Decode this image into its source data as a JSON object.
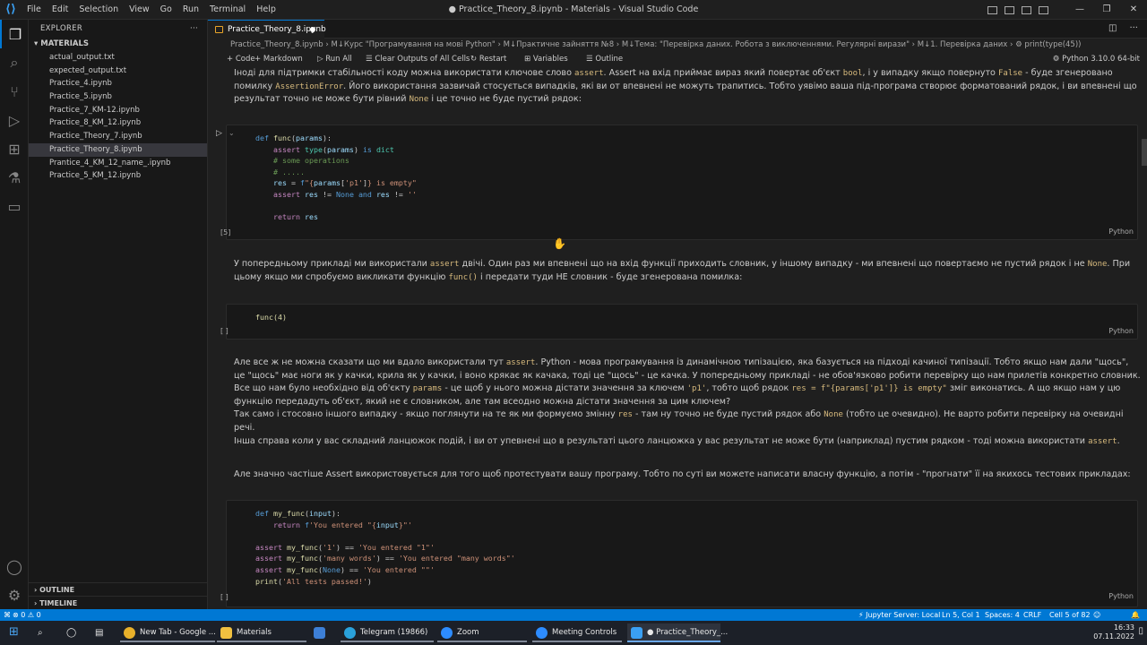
{
  "window": {
    "title": "● Practice_Theory_8.ipynb - Materials - Visual Studio Code",
    "menu": [
      "File",
      "Edit",
      "Selection",
      "View",
      "Go",
      "Run",
      "Terminal",
      "Help"
    ]
  },
  "sidebar": {
    "header": "EXPLORER",
    "folder": "MATERIALS",
    "files": [
      "actual_output.txt",
      "expected_output.txt",
      "Practice_4.ipynb",
      "Practice_5.ipynb",
      "Practice_7_KM-12.ipynb",
      "Practice_8_KM_12.ipynb",
      "Practice_Theory_7.ipynb",
      "Practice_Theory_8.ipynb",
      "Prantice_4_KM_12_name_.ipynb",
      "Practice_5_KM_12.ipynb"
    ],
    "active_index": 7,
    "outline": "OUTLINE",
    "timeline": "TIMELINE"
  },
  "tab": {
    "label": "Practice_Theory_8.ipynb"
  },
  "breadcrumb": "Practice_Theory_8.ipynb › M↓Курс \"Програмування на мові Python\" › M↓Практичне зайняття №8 › M↓Тема: \"Перевірка даних. Робота з виключеннями. Регулярні вирази\" › M↓1. Перевірка даних › ⚙ print(type(45))",
  "toolbar": {
    "code": "+ Code",
    "markdown": "+ Markdown",
    "run_all": "▷ Run All",
    "clear": "☰ Clear Outputs of All Cells",
    "restart": "↻ Restart",
    "variables": "⊞ Variables",
    "outline": "☰ Outline",
    "kernel": "Python 3.10.0 64-bit"
  },
  "cells": {
    "md1_a": "Іноді для підтримки стабільності коду можна використати ключове слово ",
    "md1_assert": "assert",
    "md1_b": ". Assert на вхід приймає вираз який повертає об'єкт ",
    "md1_bool": "bool",
    "md1_c": ", і у випадку якщо повернуто ",
    "md1_false": "False",
    "md1_d": " - буде згенеровано помилку ",
    "md1_err": "AssertionError",
    "md1_e": ". Його використання зазвичай стосується випадків, які ви от впевнені не можуть трапитись. Тобто уявімо ваша під-програма створює форматований рядок, і ви впевнені що результат точно не може бути рівний ",
    "md1_none": "None",
    "md1_f": " і це точно не буде пустий рядок:",
    "c1_exec": "[5]",
    "c1_lang": "Python",
    "md2_a": "У попередньому прикладі ми використали ",
    "md2_assert": "assert",
    "md2_b": " двічі. Один раз ми впевнені що на вхід функції приходить словник, у іншому випадку - ми впевнені що повертаємо не пустий рядок і не ",
    "md2_none": "None",
    "md2_c": ". При цьому якщо ми спробуємо викликати функцію ",
    "md2_func": "func()",
    "md2_d": " і передати туди НЕ словник - буде згенерована помилка:",
    "c2_code": "func(4)",
    "c2_exec": "[ ]",
    "c2_lang": "Python",
    "md3_a": "Але все ж не можна сказати що ми вдало використали тут ",
    "md3_assert": "assert",
    "md3_b": ". Python - мова програмування із динамічною типізацією, яка базується на підході качиної типізації. Тобто якщо нам дали \"щось\", це \"щось\" має ноги як у качки, крила як у качки, і воно крякає як качака, тоді це \"щось\" - це качка. У попередньому прикладі - не обов'язково робити перевірку що нам прилетів конкретно словник. Все що нам було необхідно від об'єкту ",
    "md3_params": "params",
    "md3_c": " - це щоб у нього можна дістати значення за ключем ",
    "md3_p1": "'p1'",
    "md3_d": ", тобто щоб рядок ",
    "md3_res": "res = f\"{params['p1']} is empty\"",
    "md3_e": " зміг виконатись. А що якщо нам у цю функцію передадуть об'єкт, який не є словником, але там всеодно можна дістати значення за цим ключем?",
    "md4_a": "Так само і стосовно іншого випадку - якщо поглянути на те як ми формуємо змінну ",
    "md4_res": "res",
    "md4_b": " - там ну точно не буде пустий рядок або ",
    "md4_none": "None",
    "md4_c": " (тобто це очевидно). Не варто робити перевірку на очевидні речі.",
    "md5_a": "Інша справа коли у вас складний ланцюжок подій, і ви от упевнені що в результаті цього ланцюжка у вас результат не може бути (наприклад) пустим рядком - тоді можна використати ",
    "md5_assert": "assert",
    "md5_b": ".",
    "md6": "Але значно частіше Assert використовується для того щоб протестувати вашу програму. Тобто по суті ви можете написати власну функцію, а потім - \"прогнати\" її на якихось тестових прикладах:",
    "c3_exec": "[ ]",
    "c3_lang": "Python"
  },
  "statusbar": {
    "problems": "⊗ 0 ⚠ 0",
    "jupyter": "⚡ Jupyter Server: Local",
    "position": "Ln 5, Col 1",
    "spaces": "Spaces: 4",
    "eol": "CRLF",
    "cell": "Cell 5 of 82"
  },
  "taskbar": {
    "apps": [
      {
        "label": "New Tab - Google ...",
        "color": "#e8b02a"
      },
      {
        "label": "Materials",
        "color": "#f0c040"
      },
      {
        "label": "",
        "color": "#3d7fd6"
      },
      {
        "label": "Telegram (19866)",
        "color": "#2aa1da"
      },
      {
        "label": "Zoom",
        "color": "#2d8cff"
      },
      {
        "label": "Meeting Controls",
        "color": "#2d8cff"
      },
      {
        "label": "● Practice_Theory_...",
        "color": "#3aa0f3"
      }
    ],
    "time": "16:33",
    "date": "07.11.2022"
  }
}
